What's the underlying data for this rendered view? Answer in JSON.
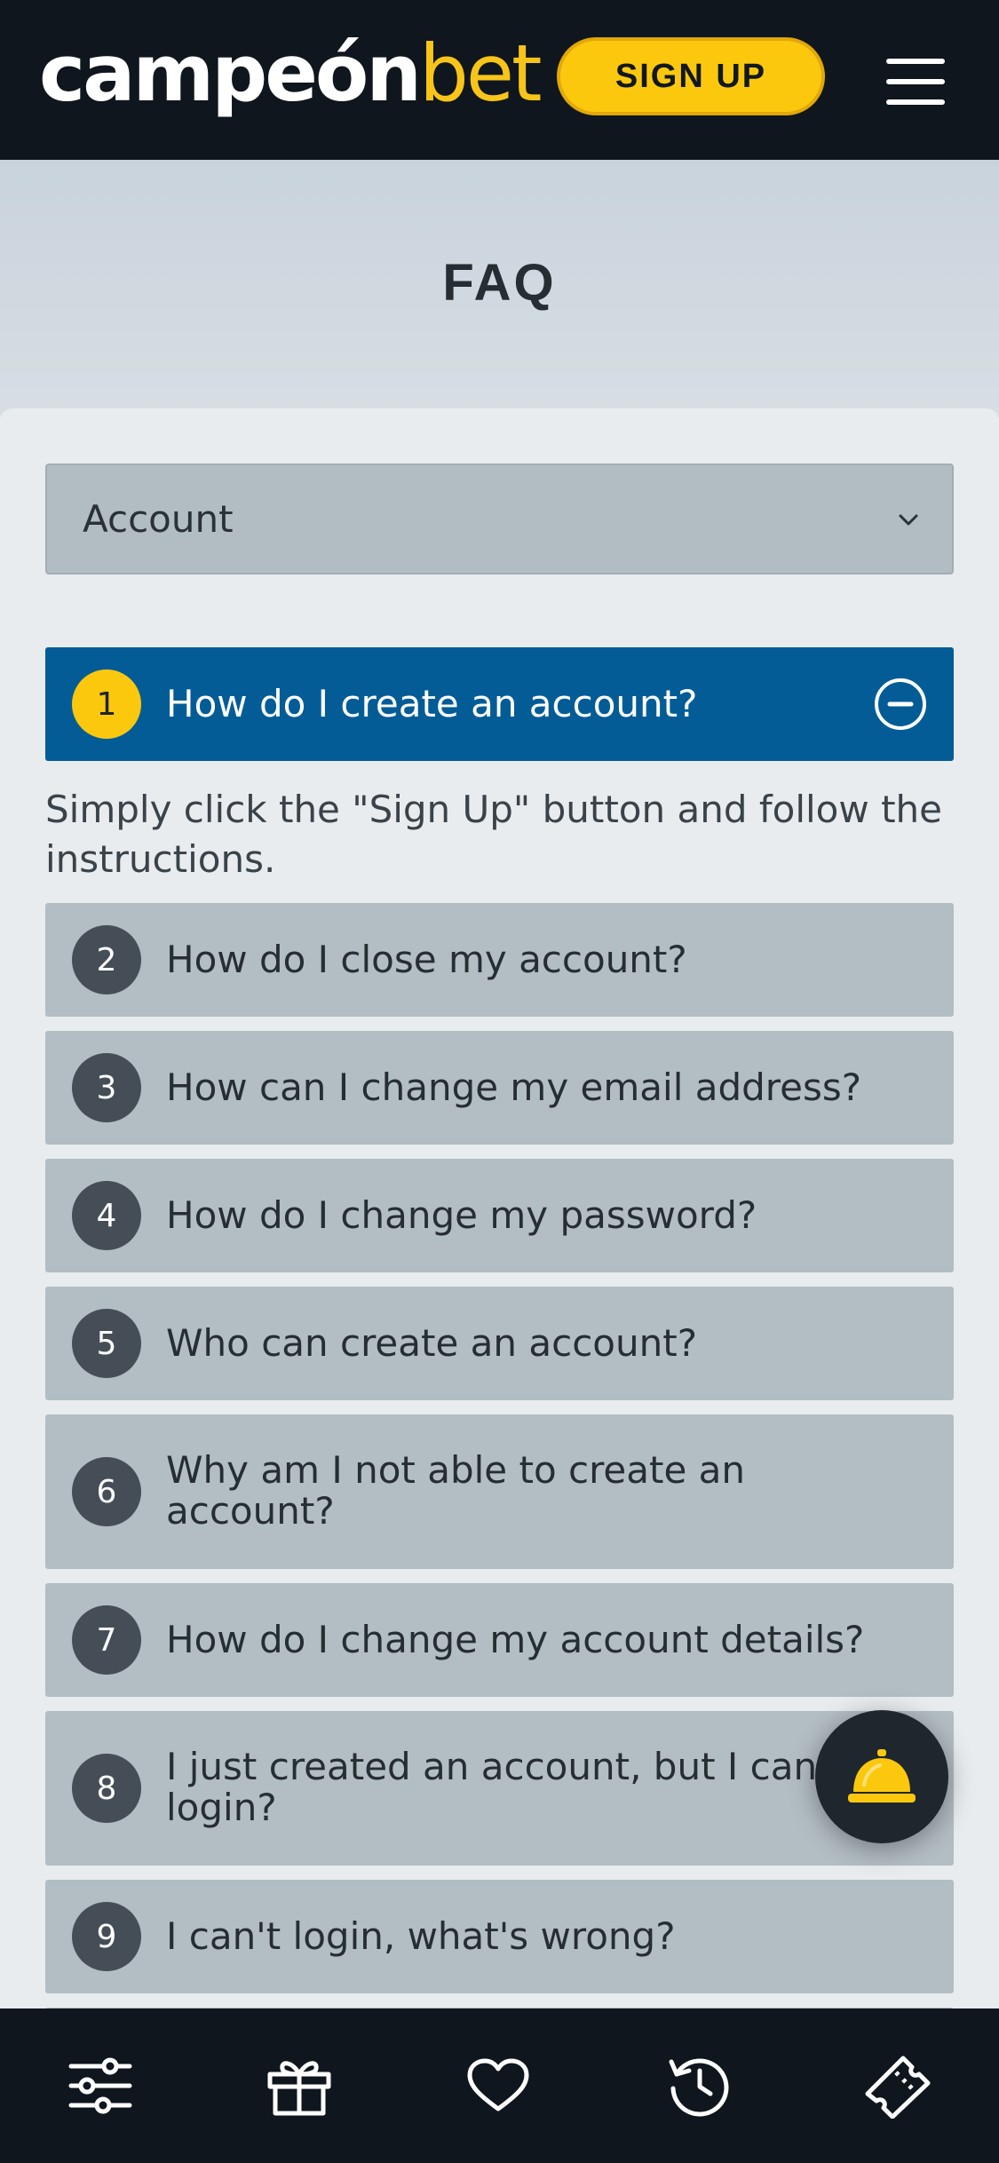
{
  "header": {
    "logo_part1": "campeón",
    "logo_part2": "bet",
    "signup_label": "SIGN UP",
    "menu_icon": "hamburger-menu-icon"
  },
  "page": {
    "title": "FAQ"
  },
  "category_select": {
    "selected": "Account",
    "icon": "chevron-down-icon"
  },
  "faq": {
    "answer_1": "Simply click the \"Sign Up\" button and follow the instructions.",
    "items": [
      {
        "num": "1",
        "question": "How do I create an account?",
        "open": true
      },
      {
        "num": "2",
        "question": "How do I close my account?"
      },
      {
        "num": "3",
        "question": "How can I change my email address?"
      },
      {
        "num": "4",
        "question": "How do I change my password?"
      },
      {
        "num": "5",
        "question": "Who can create an account?"
      },
      {
        "num": "6",
        "question": "Why am I not able to create an account?"
      },
      {
        "num": "7",
        "question": "How do I change my account details?"
      },
      {
        "num": "8",
        "question": "I just created an account, but I can't login?"
      },
      {
        "num": "9",
        "question": "I can't login, what's wrong?"
      }
    ]
  },
  "fab": {
    "icon": "service-bell-icon"
  },
  "bottom_nav": {
    "items": [
      {
        "icon": "sliders-icon"
      },
      {
        "icon": "gift-icon"
      },
      {
        "icon": "heart-icon"
      },
      {
        "icon": "history-icon"
      },
      {
        "icon": "ticket-icon"
      }
    ]
  },
  "colors": {
    "header_bg": "#0f161d",
    "brand_yellow": "#fcc80e",
    "active_blue": "#045c97",
    "item_bg": "#b3bdc4"
  }
}
